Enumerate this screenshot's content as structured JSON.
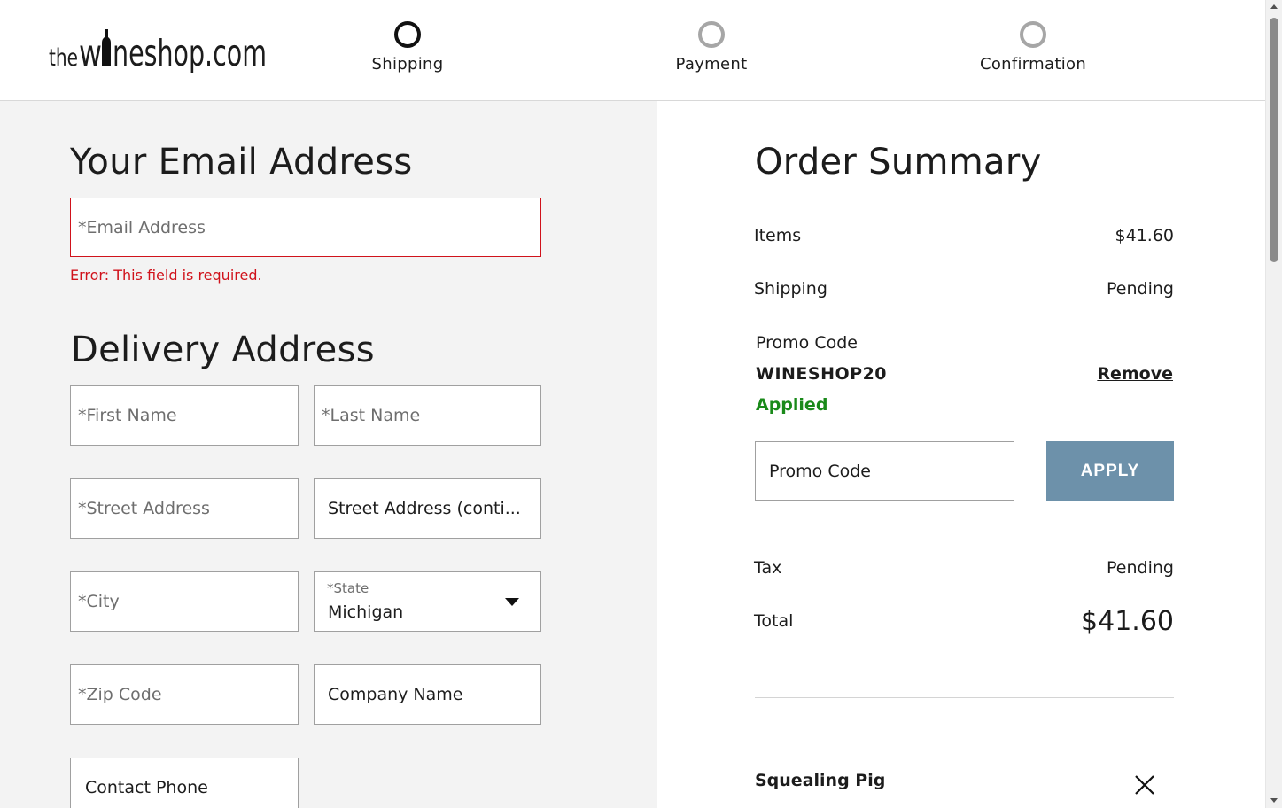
{
  "header": {
    "logo_text": "thewineshop.com",
    "steps": [
      {
        "label": "Shipping",
        "active": true
      },
      {
        "label": "Payment",
        "active": false
      },
      {
        "label": "Confirmation",
        "active": false
      }
    ]
  },
  "email_section": {
    "title": "Your Email Address",
    "email_placeholder": "*Email Address",
    "email_value": "",
    "error_text": "Error: This field is required."
  },
  "delivery": {
    "title": "Delivery Address",
    "first_name_placeholder": "*First Name",
    "last_name_placeholder": "*Last Name",
    "street_placeholder": "*Street Address",
    "street_cont_value": "Street Address (conti...",
    "city_placeholder": "*City",
    "state_label": "*State",
    "state_value": "Michigan",
    "zip_placeholder": "*Zip Code",
    "company_value": "Company Name",
    "phone_value": "Contact Phone"
  },
  "summary": {
    "title": "Order Summary",
    "items_label": "Items",
    "items_value": "$41.60",
    "shipping_label": "Shipping",
    "shipping_value": "Pending",
    "promo_label": "Promo Code",
    "promo_code": "WINESHOP20",
    "promo_status": "Applied",
    "remove_label": "Remove",
    "promo_input_value": "Promo Code",
    "apply_label": "APPLY",
    "tax_label": "Tax",
    "tax_value": "Pending",
    "total_label": "Total",
    "total_value": "$41.60",
    "product_name": "Squealing Pig"
  },
  "colors": {
    "error": "#d0121b",
    "applied": "#1a8a1a",
    "apply_button": "#6d91aa",
    "left_panel_bg": "#f3f3f3"
  }
}
